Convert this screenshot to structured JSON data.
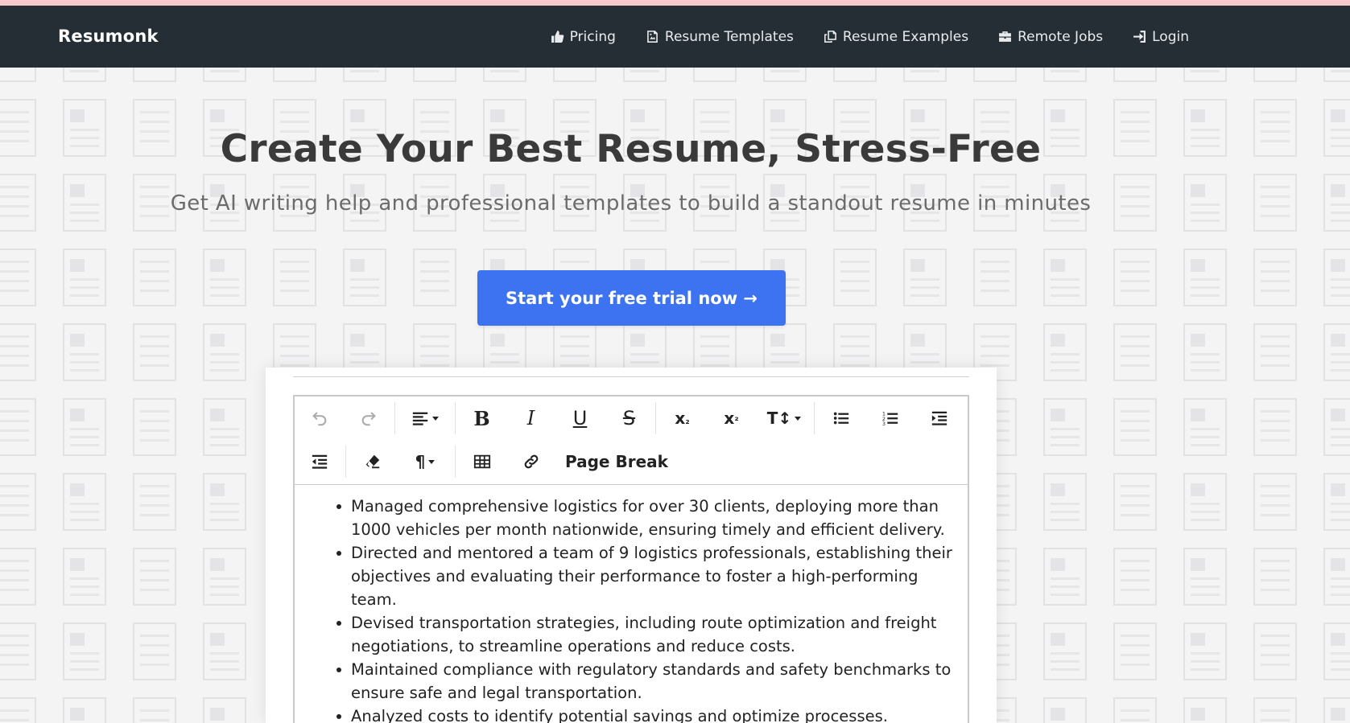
{
  "brand": "Resumonk",
  "nav": [
    {
      "label": "Pricing",
      "icon": "thumbs-up-icon"
    },
    {
      "label": "Resume Templates",
      "icon": "file-image-icon"
    },
    {
      "label": "Resume Examples",
      "icon": "copy-icon"
    },
    {
      "label": "Remote Jobs",
      "icon": "briefcase-icon"
    },
    {
      "label": "Login",
      "icon": "sign-in-icon"
    }
  ],
  "hero": {
    "title": "Create Your Best Resume, Stress-Free",
    "subtitle": "Get AI writing help and professional templates to build a standout resume in minutes",
    "cta": "Start your free trial now →"
  },
  "editor": {
    "toolbar": {
      "page_break": "Page Break"
    },
    "bullets": [
      "Managed comprehensive logistics for over 30 clients, deploying more than 1000 vehicles per month nationwide, ensuring timely and efficient delivery.",
      "Directed and mentored a team of 9 logistics professionals, establishing their objectives and evaluating their performance to foster a high-performing team.",
      "Devised transportation strategies, including route optimization and freight negotiations, to streamline operations and reduce costs.",
      "Maintained compliance with regulatory standards and safety benchmarks to ensure safe and legal transportation.",
      "Analyzed costs to identify potential savings and optimize processes."
    ]
  },
  "colors": {
    "navbar": "#252e35",
    "top_strip": "#f6c9cf",
    "cta": "#3d73f0",
    "background": "#f4f4f5"
  }
}
